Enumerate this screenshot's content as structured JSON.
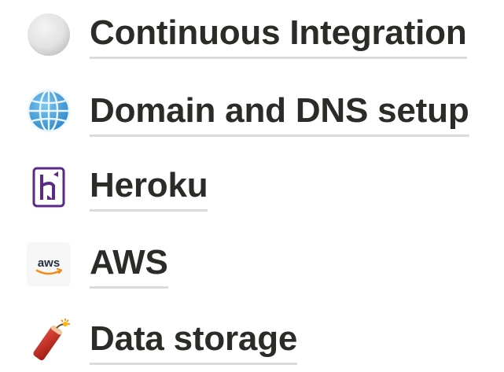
{
  "pages": [
    {
      "label": "Continuous Integration",
      "icon": "white-circle-icon"
    },
    {
      "label": "Domain and DNS setup",
      "icon": "globe-with-meridians-icon"
    },
    {
      "label": "Heroku",
      "icon": "heroku-logo-icon"
    },
    {
      "label": "AWS",
      "icon": "aws-logo-icon",
      "icon_text": "aws"
    },
    {
      "label": "Data storage",
      "icon": "firecracker-icon"
    }
  ],
  "colors": {
    "text": "#2c2b28",
    "underline": "#dcdbd8",
    "heroku_purple": "#5b2a86",
    "globe_blue": "#3b9bd9",
    "firecracker_red": "#c8281e"
  }
}
